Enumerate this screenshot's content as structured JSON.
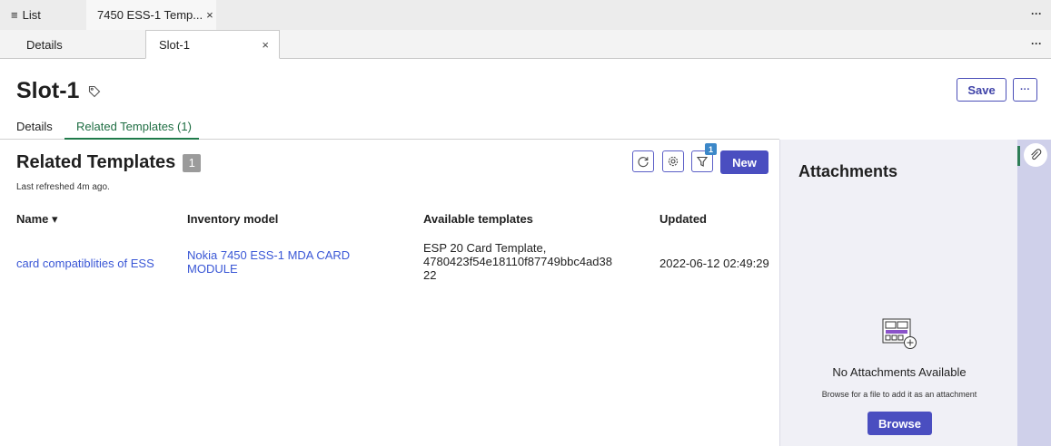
{
  "top_tabs": {
    "list_icon": "hamburger-icon",
    "list_label": "List",
    "doc_label": "7450 ESS-1 Temp...",
    "close_glyph": "×",
    "more_glyph": "···"
  },
  "sub_tabs": {
    "details_label": "Details",
    "slot_label": "Slot-1",
    "close_glyph": "×",
    "more_glyph": "···"
  },
  "header": {
    "title": "Slot-1",
    "tag_icon": "tag-icon",
    "save_label": "Save",
    "more_glyph": "···"
  },
  "inner_tabs": {
    "details_label": "Details",
    "related_label": "Related Templates (1)"
  },
  "related": {
    "title": "Related Templates",
    "count": "1",
    "last_refreshed": "Last refreshed 4m ago.",
    "filter_badge": "1",
    "new_label": "New",
    "columns": {
      "name": "Name ▾",
      "inventory": "Inventory model",
      "available": "Available templates",
      "updated": "Updated"
    },
    "rows": [
      {
        "name": "card compatiblities of ESS",
        "inventory": "Nokia 7450 ESS-1 MDA CARD MODULE",
        "available_line1": "ESP 20 Card Template,",
        "available_line2": "4780423f54e18110f87749bbc4ad38",
        "available_line3": "22",
        "updated": "2022-06-12 02:49:29"
      }
    ]
  },
  "attachments": {
    "title": "Attachments",
    "empty_title": "No Attachments Available",
    "empty_hint": "Browse for a file to add it as an attachment",
    "browse_label": "Browse"
  },
  "colors": {
    "accent": "#4a4ec0",
    "link": "#3a57d6",
    "active_tab": "#1f7a4a",
    "filter_badge": "#3b87c8"
  }
}
